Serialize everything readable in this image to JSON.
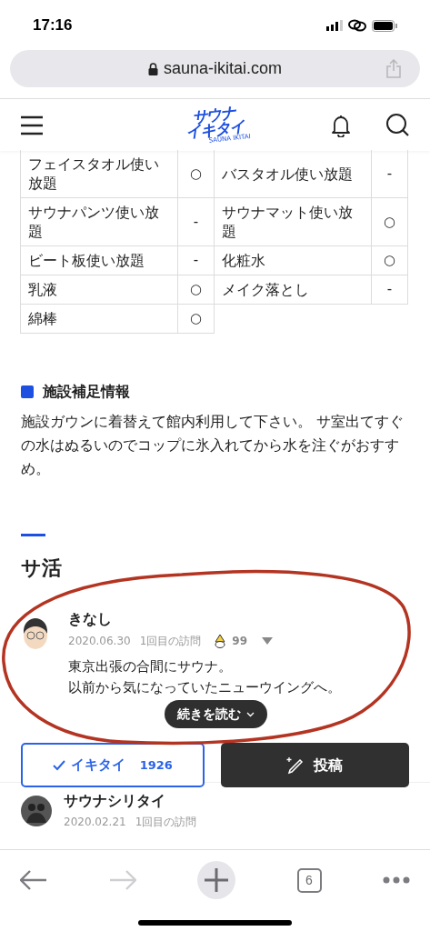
{
  "status_bar": {
    "time": "17:16"
  },
  "address_bar": {
    "url": "sauna-ikitai.com"
  },
  "header": {
    "logo_lines": [
      "サウナ",
      "イキタイ"
    ],
    "logo_sub": "SAUNA IKITAI"
  },
  "amenities": [
    {
      "label": "フェイスタオル使い放題",
      "mark": "○"
    },
    {
      "label": "バスタオル使い放題",
      "mark": "-"
    },
    {
      "label": "サウナパンツ使い放題",
      "mark": "-"
    },
    {
      "label": "サウナマット使い放題",
      "mark": "○"
    },
    {
      "label": "ビート板使い放題",
      "mark": "-"
    },
    {
      "label": "化粧水",
      "mark": "○"
    },
    {
      "label": "乳液",
      "mark": "○"
    },
    {
      "label": "メイク落とし",
      "mark": "-"
    },
    {
      "label": "綿棒",
      "mark": "○"
    }
  ],
  "notes": {
    "title": "施設補足情報",
    "text": "施設ガウンに着替えて館内利用して下さい。 サ室出てすぐの水はぬるいのでコップに氷入れてから水を注ぐがおすすめ。"
  },
  "section": {
    "title": "サ活"
  },
  "posts": [
    {
      "user": "きなし",
      "date": "2020.06.30",
      "visit": "1回目の訪問",
      "score": "99",
      "lines": [
        "東京出張の合間にサウナ。",
        "以前から気になっていたニューウイングへ。"
      ],
      "more": "続きを読む"
    },
    {
      "user": "サウナシリタイ",
      "date": "2020.02.21",
      "visit": "1回目の訪問"
    }
  ],
  "actions": {
    "ikitai": {
      "label": "イキタイ",
      "count": "1926"
    },
    "post": {
      "label": "投稿"
    }
  },
  "toolbar": {
    "tabs": "6"
  }
}
